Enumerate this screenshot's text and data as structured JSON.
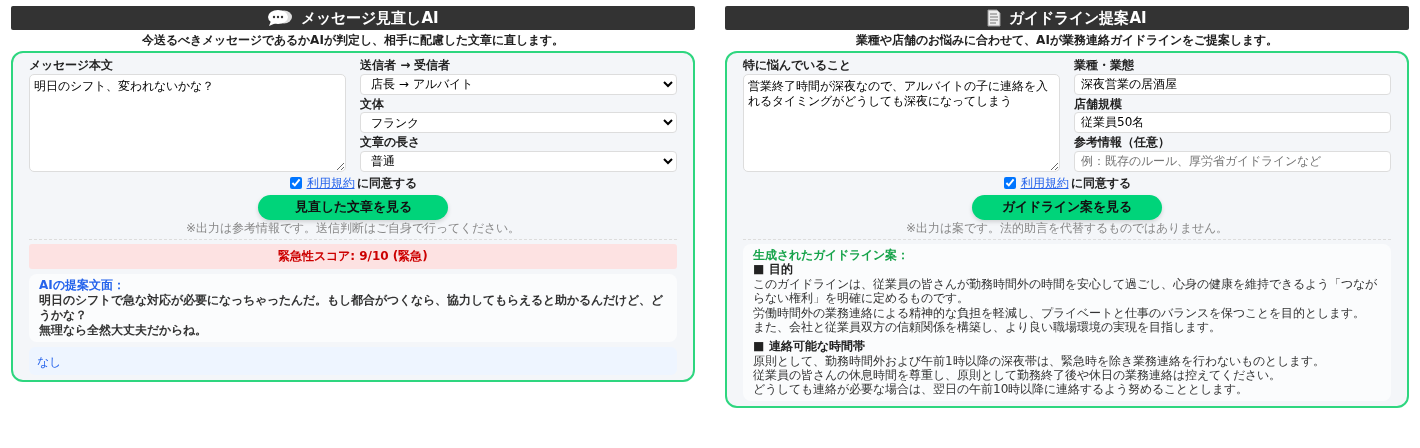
{
  "panels": [
    {
      "kind": "chat",
      "title": "メッセージ見直しAI",
      "description": "今送るべきメッセージであるかAIが判定し、相手に配慮した文章に直します。",
      "main_field": {
        "label": "メッセージ本文",
        "value": "明日のシフト、変われないかな？"
      },
      "side_fields": [
        {
          "kind": "select",
          "label": "送信者 → 受信者",
          "value": "店長 → アルバイト"
        },
        {
          "kind": "select",
          "label": "文体",
          "value": "フランク"
        },
        {
          "kind": "select",
          "label": "文章の長さ",
          "value": "普通"
        }
      ],
      "consent": {
        "checked": true,
        "link": "利用規約",
        "text": "に同意する"
      },
      "button": "見直した文章を見る",
      "note": "※出力は参考情報です。送信判断はご自身で行ってください。",
      "results": [
        {
          "kind": "score",
          "text": "緊急性スコア: 9/10 (緊急)"
        },
        {
          "kind": "proposal",
          "label": "AIの提案文面：",
          "lines": [
            "明日のシフトで急な対応が必要になっちゃったんだ。もし都合がつくなら、協力してもらえると助かるんだけど、どうかな？",
            "無理なら全然大丈夫だからね。"
          ]
        },
        {
          "kind": "note",
          "text": "なし"
        }
      ]
    },
    {
      "kind": "document",
      "title": "ガイドライン提案AI",
      "description": "業種や店舗のお悩みに合わせて、AIが業務連絡ガイドラインをご提案します。",
      "main_field": {
        "label": "特に悩んでいること",
        "value": "営業終了時間が深夜なので、アルバイトの子に連絡を入れるタイミングがどうしても深夜になってしまう"
      },
      "side_fields": [
        {
          "kind": "input",
          "label": "業種・業態",
          "value": "深夜営業の居酒屋"
        },
        {
          "kind": "input",
          "label": "店舗規模",
          "value": "従業員50名"
        },
        {
          "kind": "input",
          "label": "参考情報（任意）",
          "placeholder": "例：既存のルール、厚労省ガイドラインなど"
        }
      ],
      "consent": {
        "checked": true,
        "link": "利用規約",
        "text": "に同意する"
      },
      "button": "ガイドライン案を見る",
      "note": "※出力は案です。法的助言を代替するものではありません。",
      "results": [
        {
          "kind": "guideline",
          "title": "生成されたガイドライン案：",
          "sections": [
            {
              "heading": "■ 目的",
              "lines": [
                "このガイドラインは、従業員の皆さんが勤務時間外の時間を安心して過ごし、心身の健康を維持できるよう「つながらない権利」を明確に定めるものです。",
                "労働時間外の業務連絡による精神的な負担を軽減し、プライベートと仕事のバランスを保つことを目的とします。",
                "また、会社と従業員双方の信頼関係を構築し、より良い職場環境の実現を目指します。"
              ]
            },
            {
              "heading": "■ 連絡可能な時間帯",
              "lines": [
                "原則として、勤務時間外および午前1時以降の深夜帯は、緊急時を除き業務連絡を行わないものとします。",
                "従業員の皆さんの休息時間を尊重し、原則として勤務終了後や休日の業務連絡は控えてください。",
                "どうしても連絡が必要な場合は、翌日の午前10時以降に連絡するよう努めることとします。"
              ]
            }
          ]
        }
      ]
    }
  ]
}
